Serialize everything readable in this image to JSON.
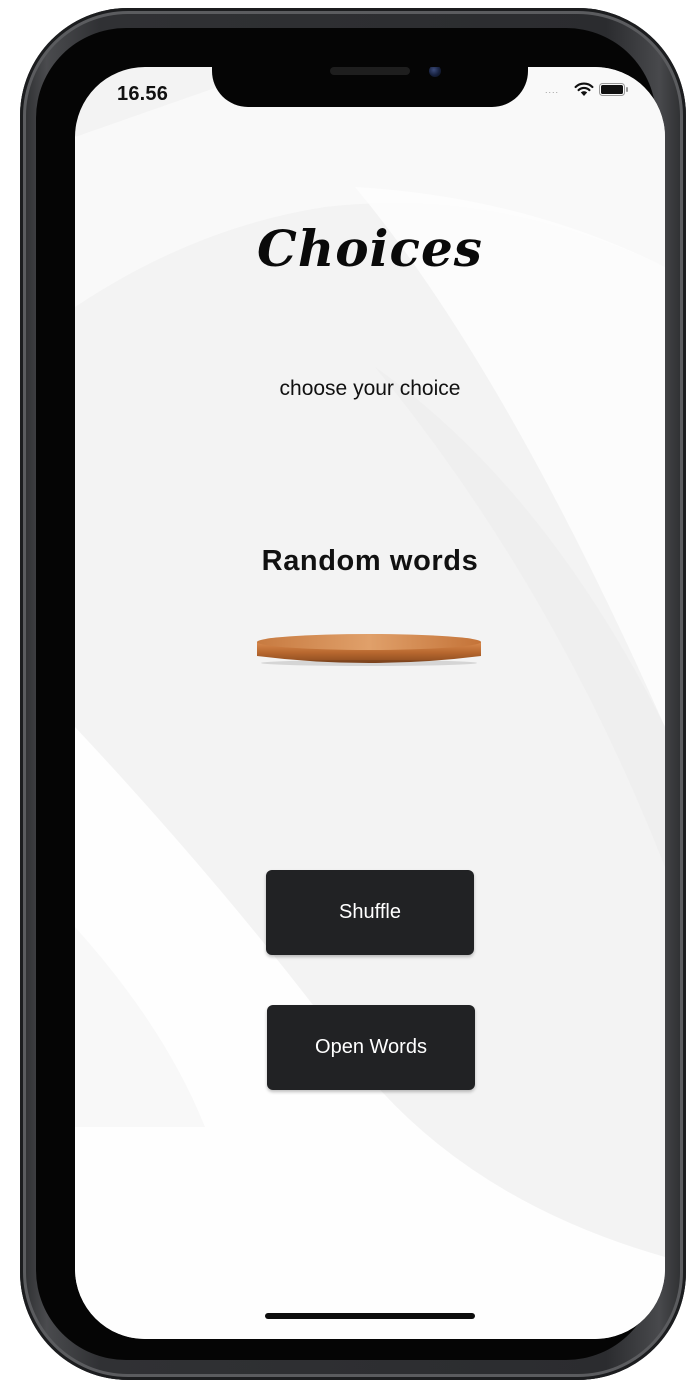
{
  "status_bar": {
    "time": "16.56",
    "signal": "....",
    "wifi_icon": "wifi-icon",
    "battery_icon": "battery-icon"
  },
  "app": {
    "title": "Choices",
    "subtitle": "choose your choice",
    "word_display": "Random words",
    "plate_icon": "wooden-plate-icon"
  },
  "buttons": {
    "shuffle_label": "Shuffle",
    "open_words_label": "Open Words"
  },
  "colors": {
    "button_bg": "#212224",
    "button_text": "#ffffff",
    "screen_bg": "#f3f3f3",
    "plate": "#c4753a"
  }
}
